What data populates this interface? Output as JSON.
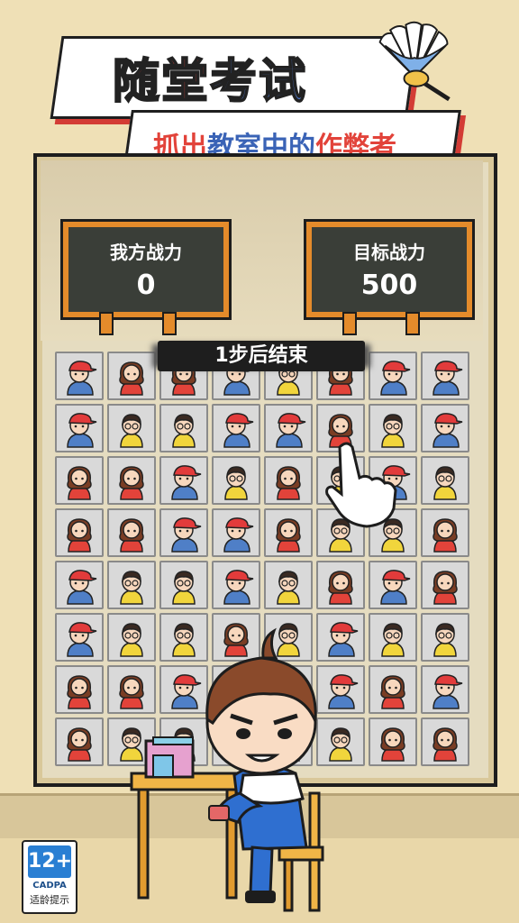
{
  "title": {
    "part1": "随堂",
    "part2": "考试"
  },
  "subtitle": {
    "a": "抓出",
    "b": "教室中的",
    "c": "作弊者"
  },
  "my_power": {
    "label": "我方战力",
    "value": "0"
  },
  "target_power": {
    "label": "目标战力",
    "value": "500"
  },
  "steps_text": "1步后结束",
  "grid": [
    [
      "boy-cap",
      "girl",
      "girl",
      "boy-cap",
      "boy-glasses",
      "girl",
      "boy-cap",
      "boy-cap"
    ],
    [
      "boy-cap",
      "boy-glasses",
      "boy-glasses",
      "boy-cap",
      "boy-cap",
      "girl",
      "boy-glasses",
      "boy-cap"
    ],
    [
      "girl",
      "girl",
      "boy-cap",
      "boy-glasses",
      "girl",
      "boy-glasses",
      "boy-cap",
      "boy-glasses"
    ],
    [
      "girl",
      "girl",
      "boy-cap",
      "boy-cap",
      "girl",
      "boy-glasses",
      "boy-glasses",
      "girl"
    ],
    [
      "boy-cap",
      "boy-glasses",
      "boy-glasses",
      "boy-cap",
      "boy-glasses",
      "girl",
      "boy-cap",
      "girl"
    ],
    [
      "boy-cap",
      "boy-glasses",
      "boy-glasses",
      "girl",
      "boy-glasses",
      "boy-cap",
      "boy-glasses",
      "boy-glasses"
    ],
    [
      "girl",
      "girl",
      "boy-cap",
      "boy-cap",
      "boy-glasses",
      "boy-cap",
      "girl",
      "boy-cap"
    ],
    [
      "girl",
      "boy-glasses",
      "boy-glasses",
      "girl",
      "boy-glasses",
      "boy-glasses",
      "girl",
      "girl"
    ]
  ],
  "age_rating": {
    "age": "12+",
    "org": "CADPA",
    "tip": "适龄提示"
  },
  "colors": {
    "accent_red": "#e2433a",
    "accent_blue": "#4d76c7",
    "chalk_frame": "#e48b2b"
  }
}
